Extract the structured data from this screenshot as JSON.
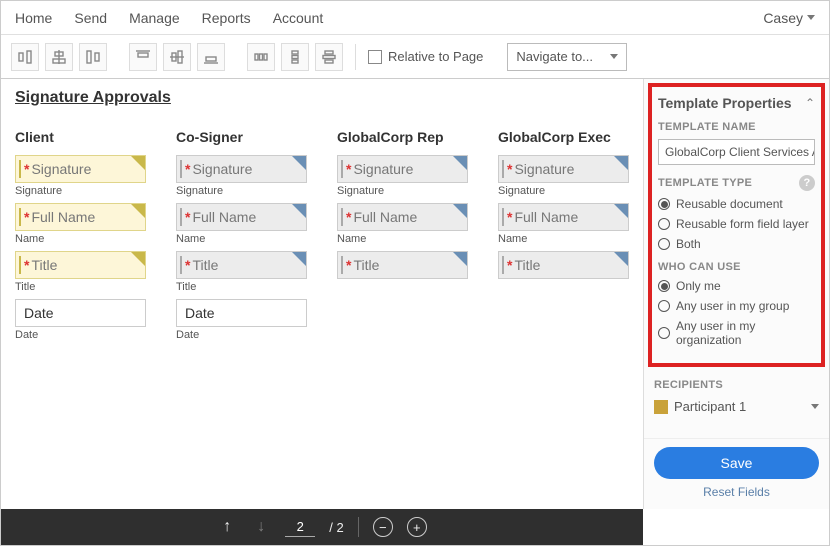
{
  "topnav": {
    "items": [
      "Home",
      "Send",
      "Manage",
      "Reports",
      "Account"
    ],
    "user": "Casey"
  },
  "toolbar": {
    "relative_label": "Relative to Page",
    "nav_select": "Navigate to..."
  },
  "doc": {
    "title": "Signature Approvals",
    "sections": [
      {
        "heading": "Client",
        "style": "yellow",
        "fields": [
          {
            "placeholder": "Signature",
            "label": "Signature",
            "required": true
          },
          {
            "placeholder": "Full Name",
            "label": "Name",
            "required": true
          },
          {
            "placeholder": "Title",
            "label": "Title",
            "required": true
          },
          {
            "placeholder": "Date",
            "label": "Date",
            "required": false,
            "white": true
          }
        ]
      },
      {
        "heading": "Co-Signer",
        "style": "gray",
        "fields": [
          {
            "placeholder": "Signature",
            "label": "Signature",
            "required": true
          },
          {
            "placeholder": "Full Name",
            "label": "Name",
            "required": true
          },
          {
            "placeholder": "Title",
            "label": "Title",
            "required": true
          },
          {
            "placeholder": "Date",
            "label": "Date",
            "required": false,
            "white": true
          }
        ]
      },
      {
        "heading": "GlobalCorp Rep",
        "style": "gray",
        "fields": [
          {
            "placeholder": "Signature",
            "label": "Signature",
            "required": true
          },
          {
            "placeholder": "Full Name",
            "label": "Name",
            "required": true
          },
          {
            "placeholder": "Title",
            "label": "",
            "required": true
          }
        ]
      },
      {
        "heading": "GlobalCorp Exec",
        "style": "gray",
        "fields": [
          {
            "placeholder": "Signature",
            "label": "Signature",
            "required": true
          },
          {
            "placeholder": "Full Name",
            "label": "Name",
            "required": true
          },
          {
            "placeholder": "Title",
            "label": "",
            "required": true
          }
        ]
      }
    ]
  },
  "panel": {
    "title": "Template Properties",
    "name_label": "TEMPLATE NAME",
    "name_value": "GlobalCorp Client Services Agreement",
    "type_label": "TEMPLATE TYPE",
    "type_options": [
      "Reusable document",
      "Reusable form field layer",
      "Both"
    ],
    "type_selected": 0,
    "who_label": "WHO CAN USE",
    "who_options": [
      "Only me",
      "Any user in my group",
      "Any user in my organization"
    ],
    "who_selected": 0,
    "recipients_label": "RECIPIENTS",
    "participant": "Participant 1",
    "save": "Save",
    "reset": "Reset Fields"
  },
  "bottombar": {
    "page": "2",
    "total": "/ 2"
  }
}
